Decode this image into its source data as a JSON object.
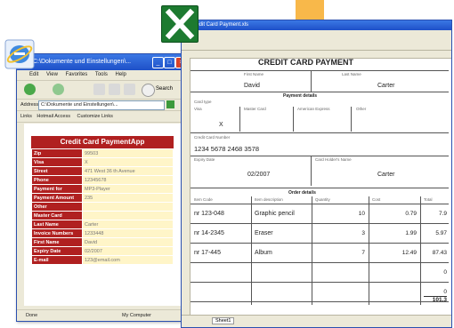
{
  "ie_window": {
    "title": "C:\\Dokumente und Einstellungen\\...",
    "menu": [
      "Edit",
      "View",
      "Favorites",
      "Tools",
      "Help"
    ],
    "search_label": "Search",
    "address_label": "Address",
    "address_value": "C:\\Dokumente und Einstellungen\\...",
    "links": [
      "Hotmail Access",
      "Customize Links"
    ],
    "status_left": "Done",
    "status_right": "My Computer"
  },
  "form": {
    "title": "Credit Card PaymentApp",
    "rows": [
      {
        "label": "Zip",
        "value": "99503"
      },
      {
        "label": "Visa",
        "value": "X"
      },
      {
        "label": "Street",
        "value": "471 West 36 th Avenue"
      },
      {
        "label": "Phone",
        "value": "12345678"
      },
      {
        "label": "Payment for",
        "value": "MP3-Player"
      },
      {
        "label": "Payment Amount",
        "value": "235"
      },
      {
        "label": "Other",
        "value": ""
      },
      {
        "label": "Master Card",
        "value": ""
      },
      {
        "label": "Last Name",
        "value": "Carter"
      },
      {
        "label": "Invoice Numbers",
        "value": "1233448"
      },
      {
        "label": "First Name",
        "value": "David"
      },
      {
        "label": "Expiry Date",
        "value": "02/2007"
      },
      {
        "label": "E-mail",
        "value": "123@email.com"
      }
    ]
  },
  "excel": {
    "title": "Credit Card Payment.xls",
    "doc_title": "CREDIT CARD PAYMENT",
    "first_name_label": "First Name",
    "last_name_label": "Last Name",
    "first_name": "David",
    "last_name": "Carter",
    "payment_details": "Payment details",
    "card_type_label": "Card type",
    "card_cols": [
      "Visa",
      "Master Card",
      "American Express",
      "Other"
    ],
    "visa_mark": "X",
    "card_number_label": "Credit Card Number",
    "card_number": "1234 5678 2468 3578",
    "expiry_label": "Expiry Date",
    "holder_label": "Card Holder's Name",
    "expiry": "02/2007",
    "holder": "Carter",
    "order_details": "Order details",
    "order_cols": [
      "Item Code",
      "Item description",
      "Quantity",
      "Cost",
      "Total"
    ],
    "items": [
      {
        "code": "nr 123-048",
        "desc": "Graphic pencil",
        "qty": "10",
        "cost": "0.79",
        "total": "7.9"
      },
      {
        "code": "nr 14-2345",
        "desc": "Eraser",
        "qty": "3",
        "cost": "1.99",
        "total": "5.97"
      },
      {
        "code": "nr 17-445",
        "desc": "Album",
        "qty": "7",
        "cost": "12.49",
        "total": "87.43"
      }
    ],
    "blank_totals": [
      "0",
      "0"
    ],
    "grand_total": "101.3",
    "sheet_tab": "Sheet1"
  }
}
